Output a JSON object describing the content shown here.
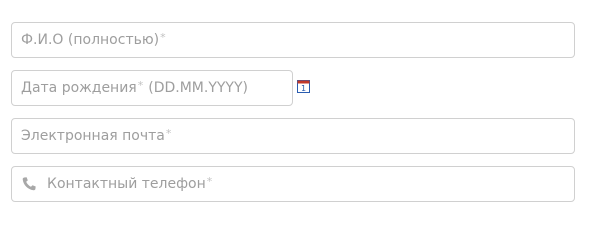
{
  "form": {
    "full_name": {
      "placeholder": "Ф.И.О (полностью)",
      "required_mark": "*"
    },
    "birth_date": {
      "placeholder": "Дата рождения",
      "required_mark": "*",
      "format_hint": "(DD.MM.YYYY)",
      "calendar_icon_text": "1"
    },
    "email": {
      "placeholder": "Электронная почта",
      "required_mark": "*"
    },
    "phone": {
      "placeholder": "Контактный телефон",
      "required_mark": "*",
      "icon": "phone-icon"
    }
  },
  "colors": {
    "border": "#d0d0d0",
    "placeholder": "#9e9e9e",
    "calendar_red": "#c0392b",
    "calendar_blue": "#2a5db0"
  }
}
